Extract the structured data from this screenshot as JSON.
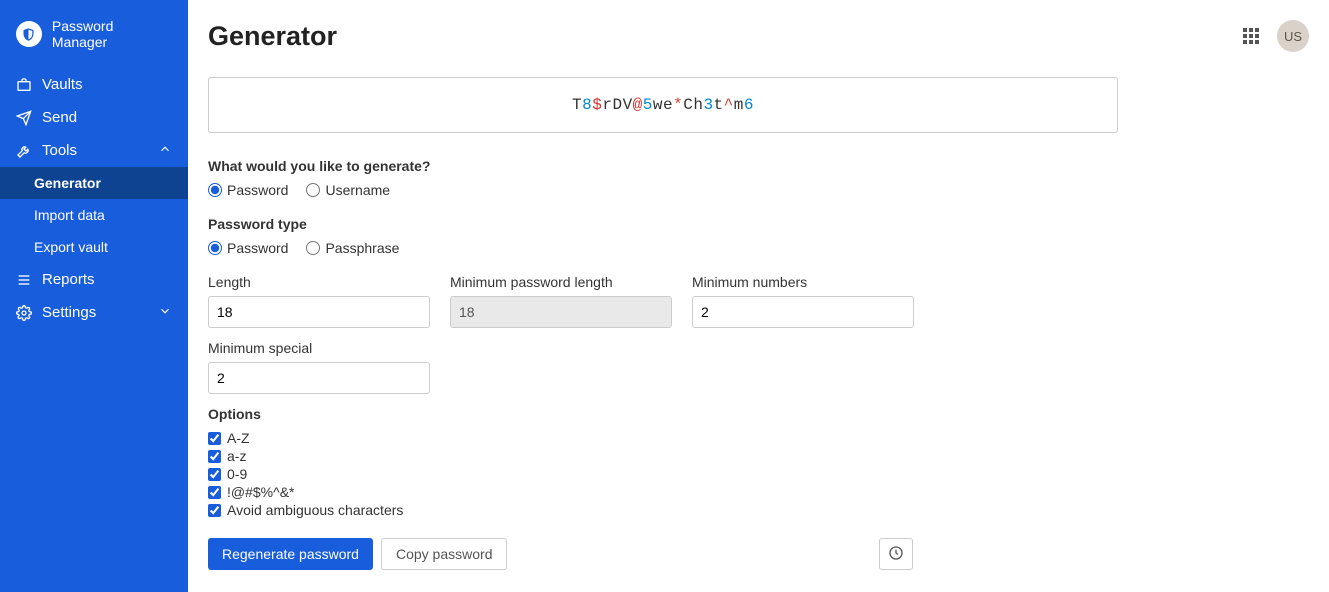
{
  "app_name": "Password Manager",
  "sidebar": {
    "items": [
      {
        "label": "Vaults",
        "icon": "vault-icon"
      },
      {
        "label": "Send",
        "icon": "send-icon"
      },
      {
        "label": "Tools",
        "icon": "tools-icon",
        "expanded": true
      },
      {
        "label": "Reports",
        "icon": "reports-icon"
      },
      {
        "label": "Settings",
        "icon": "settings-icon",
        "expanded": false
      }
    ],
    "tools_subitems": [
      {
        "label": "Generator",
        "selected": true
      },
      {
        "label": "Import data"
      },
      {
        "label": "Export vault"
      }
    ]
  },
  "header": {
    "title": "Generator",
    "avatar_initials": "US"
  },
  "generator": {
    "password_tokens": [
      {
        "t": "T",
        "c": "letter"
      },
      {
        "t": "8",
        "c": "digit"
      },
      {
        "t": "$",
        "c": "special"
      },
      {
        "t": "r",
        "c": "letter"
      },
      {
        "t": "D",
        "c": "letter"
      },
      {
        "t": "V",
        "c": "letter"
      },
      {
        "t": "@",
        "c": "special"
      },
      {
        "t": "5",
        "c": "digit"
      },
      {
        "t": "w",
        "c": "letter"
      },
      {
        "t": "e",
        "c": "letter"
      },
      {
        "t": "*",
        "c": "special"
      },
      {
        "t": "C",
        "c": "letter"
      },
      {
        "t": "h",
        "c": "letter"
      },
      {
        "t": "3",
        "c": "digit"
      },
      {
        "t": "t",
        "c": "letter"
      },
      {
        "t": "^",
        "c": "special"
      },
      {
        "t": "m",
        "c": "letter"
      },
      {
        "t": "6",
        "c": "digit"
      }
    ],
    "what_label": "What would you like to generate?",
    "what_options": {
      "password": "Password",
      "username": "Username"
    },
    "what_selected": "password",
    "ptype_label": "Password type",
    "ptype_options": {
      "password": "Password",
      "passphrase": "Passphrase"
    },
    "ptype_selected": "password",
    "fields": {
      "length": {
        "label": "Length",
        "value": "18"
      },
      "min_length": {
        "label": "Minimum password length",
        "value": "18",
        "disabled": true
      },
      "min_numbers": {
        "label": "Minimum numbers",
        "value": "2"
      },
      "min_special": {
        "label": "Minimum special",
        "value": "2"
      }
    },
    "options_label": "Options",
    "options": [
      {
        "key": "upper",
        "label": "A-Z",
        "checked": true
      },
      {
        "key": "lower",
        "label": "a-z",
        "checked": true
      },
      {
        "key": "digits",
        "label": "0-9",
        "checked": true
      },
      {
        "key": "special",
        "label": "!@#$%^&*",
        "checked": true
      },
      {
        "key": "ambiguous",
        "label": "Avoid ambiguous characters",
        "checked": true
      }
    ],
    "buttons": {
      "regenerate": "Regenerate password",
      "copy": "Copy password"
    }
  }
}
